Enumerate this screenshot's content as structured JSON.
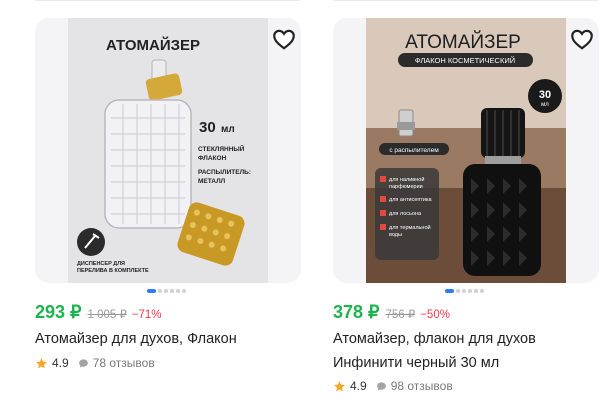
{
  "products": [
    {
      "image": {
        "heading": "АТОМАЙЗЕР",
        "volume_num": "30",
        "volume_unit": "мл",
        "spec_line1": "СТЕКЛЯННЫЙ",
        "spec_line2": "ФЛАКОН",
        "spec_line3": "РАСПЫЛИТЕЛЬ:",
        "spec_line4": "МЕТАЛЛ",
        "dispenser_line1": "ДИСПЕНСЕР ДЛЯ",
        "dispenser_line2": "ПЕРЕЛИВА В КОМПЛЕКТЕ"
      },
      "price": "293 ₽",
      "old_price": "1 005 ₽",
      "discount": "−71%",
      "title_line1": "Атомайзер для духов, Флакон",
      "rating": "4.9",
      "reviews": "78 отзывов",
      "favorite_icon": "heart-outline-icon"
    },
    {
      "image": {
        "heading": "АТОМАЙЗЕР",
        "banner": "ФЛАКОН КОСМЕТИЧЕСКИЙ",
        "volume_num": "30",
        "volume_unit": "мл",
        "sprayer_label": "с распылителем",
        "feature1": "для наливной",
        "feature1b": "парфюмерии",
        "feature2": "для антисептика",
        "feature3": "для лосьона",
        "feature4": "для термальной",
        "feature4b": "воды"
      },
      "price": "378 ₽",
      "old_price": "756 ₽",
      "discount": "−50%",
      "title_line1": "Атомайзер, флакон для духов",
      "title_line2": "Инфинити черный 30 мл",
      "rating": "4.9",
      "reviews": "98 отзывов",
      "favorite_icon": "heart-outline-icon"
    }
  ],
  "colors": {
    "price": "#1fb34f",
    "discount": "#f0394a",
    "star": "#f5a623",
    "active_dot": "#2f7cf6"
  }
}
